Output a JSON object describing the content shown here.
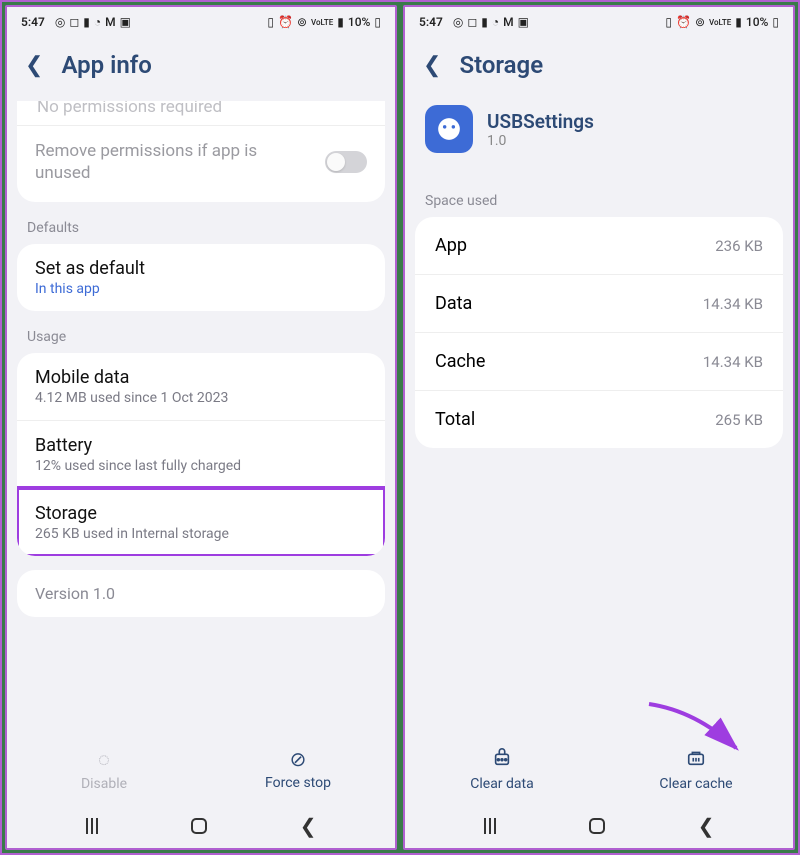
{
  "statusbar": {
    "time": "5:47",
    "left_icons": [
      "whatsapp",
      "instagram",
      "battery-sm",
      "cloud",
      "gmail",
      "photo"
    ],
    "right_icons": [
      "alarm-icon",
      "clock-icon",
      "wifi-icon",
      "vol-lte-icon",
      "signal-icon"
    ],
    "battery_text": "10%"
  },
  "left": {
    "title": "App info",
    "cutoff_permission": "No permissions required",
    "remove_permissions_label": "Remove permissions if app is unused",
    "sections": {
      "defaults": "Defaults",
      "usage": "Usage"
    },
    "set_default": {
      "title": "Set as default",
      "sub": "In this app"
    },
    "mobile_data": {
      "title": "Mobile data",
      "sub": "4.12 MB used since 1 Oct 2023"
    },
    "battery": {
      "title": "Battery",
      "sub": "12% used since last fully charged"
    },
    "storage": {
      "title": "Storage",
      "sub": "265 KB used in Internal storage"
    },
    "version": "Version 1.0",
    "actions": {
      "disable": "Disable",
      "force_stop": "Force stop"
    }
  },
  "right": {
    "title": "Storage",
    "app": {
      "name": "USBSettings",
      "version": "1.0"
    },
    "section_label": "Space used",
    "rows": {
      "app": {
        "label": "App",
        "value": "236 KB"
      },
      "data": {
        "label": "Data",
        "value": "14.34 KB"
      },
      "cache": {
        "label": "Cache",
        "value": "14.34 KB"
      },
      "total": {
        "label": "Total",
        "value": "265 KB"
      }
    },
    "actions": {
      "clear_data": "Clear data",
      "clear_cache": "Clear cache"
    }
  }
}
